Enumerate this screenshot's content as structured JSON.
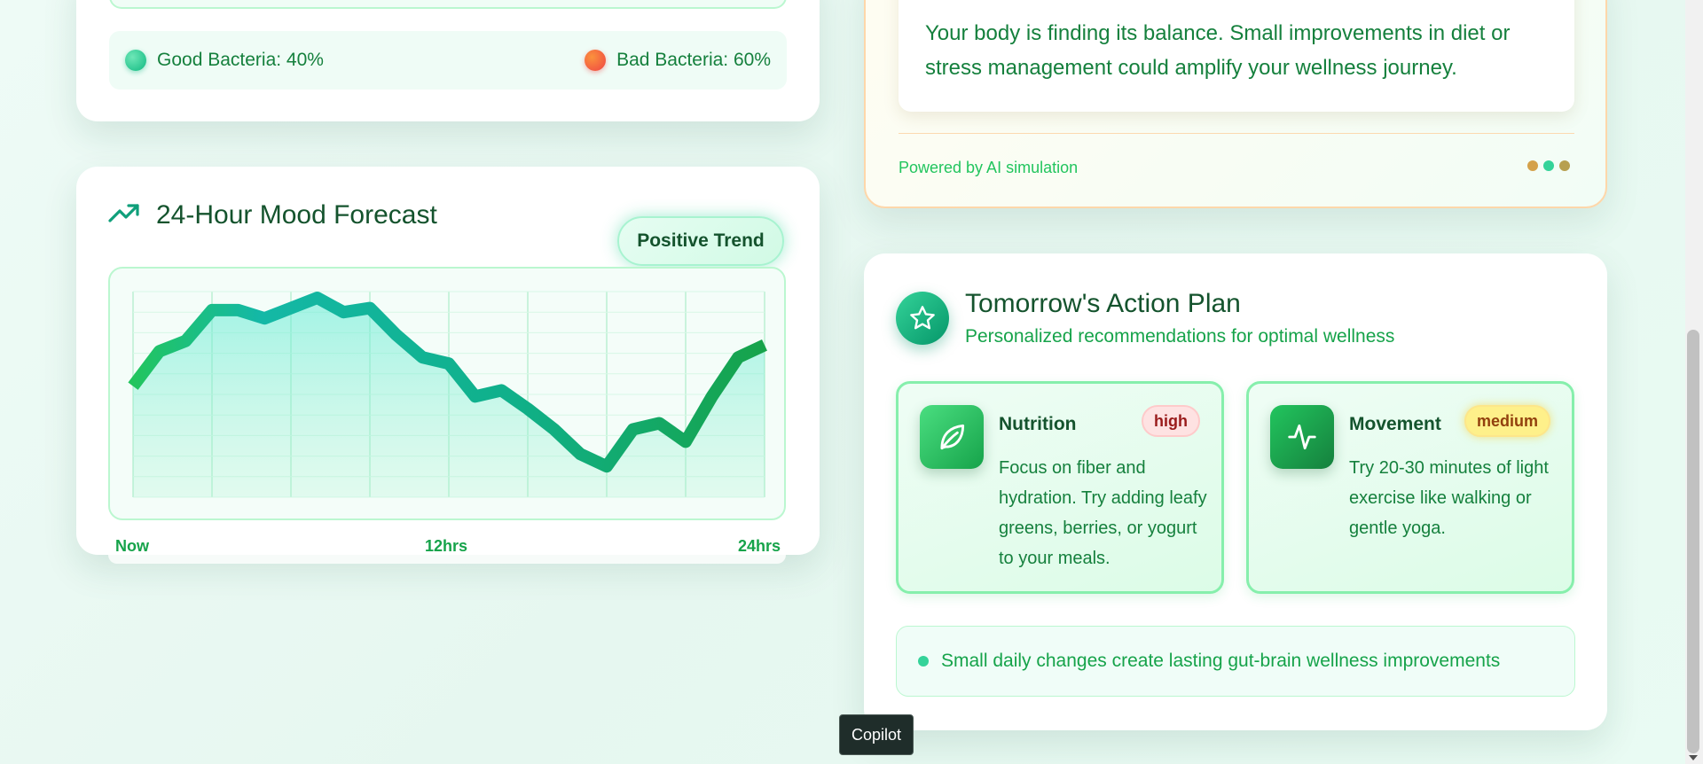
{
  "bacteria": {
    "good_label": "Good Bacteria: 40%",
    "bad_label": "Bad Bacteria: 60%",
    "good_pct": 40,
    "bad_pct": 60,
    "colors": {
      "good": "#10b981",
      "bad": "#ef4444"
    }
  },
  "mood": {
    "title": "24-Hour Mood Forecast",
    "badge": "Positive Trend",
    "icon": "trending-up-icon",
    "x_labels": [
      "Now",
      "12hrs",
      "24hrs"
    ]
  },
  "chart_data": {
    "type": "area",
    "x": [
      0,
      1,
      2,
      3,
      4,
      5,
      6,
      7,
      8,
      9,
      10,
      11,
      12,
      13,
      14,
      15,
      16,
      17,
      18,
      19,
      20,
      21,
      22,
      23,
      24
    ],
    "values": [
      54,
      71,
      76,
      91,
      91,
      87,
      92,
      97,
      90,
      92,
      79,
      68,
      65,
      49,
      52,
      43,
      33,
      21,
      15,
      33,
      36,
      27,
      49,
      68,
      74
    ],
    "series": [
      {
        "values": [
          54,
          71,
          76,
          91,
          91,
          87,
          92,
          97,
          90,
          92,
          79,
          68,
          65,
          49,
          52,
          43,
          33,
          21,
          15,
          33,
          36,
          27,
          49,
          68,
          74
        ]
      }
    ],
    "tick_labels": [
      "Now",
      "12hrs",
      "24hrs"
    ],
    "ylim": [
      0,
      100
    ],
    "grid": true,
    "colors": {
      "line_start": "#22c55e",
      "line_mid": "#14b8a6",
      "fill": "#5eead4"
    }
  },
  "ai": {
    "message": "Your body is finding its balance. Small improvements in diet or stress management could amplify your wellness journey.",
    "footer": "Powered by AI simulation",
    "dot_colors": [
      "#d4a14a",
      "#34d399",
      "#b7a050"
    ]
  },
  "plan": {
    "title": "Tomorrow's Action Plan",
    "subtitle": "Personalized recommendations for optimal wellness",
    "icon": "star-icon",
    "recommendations": [
      {
        "title": "Nutrition",
        "priority": "high",
        "icon": "leaf-icon",
        "text": "Focus on fiber and hydration. Try adding leafy greens, berries, or yogurt to your meals."
      },
      {
        "title": "Movement",
        "priority": "medium",
        "icon": "activity-icon",
        "text": "Try 20-30 minutes of light exercise like walking or gentle yoga."
      }
    ],
    "footer": "Small daily changes create lasting gut-brain wellness improvements"
  },
  "tooltip": {
    "label": "Copilot"
  }
}
